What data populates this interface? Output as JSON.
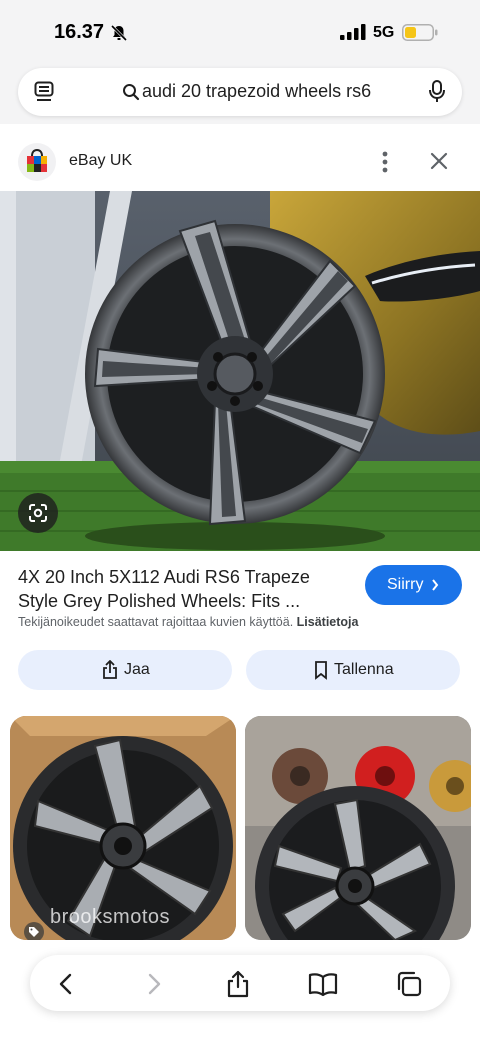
{
  "status_bar": {
    "time": "16.37",
    "network": "5G",
    "battery_color": "#f5c518"
  },
  "search": {
    "query": "audi 20 trapezoid wheels rs6"
  },
  "source": {
    "name": "eBay UK"
  },
  "result": {
    "title_line1": "4X 20 Inch 5X112 Audi RS6 Trapeze",
    "title_line2": "Style Grey Polished Wheels: Fits ...",
    "go_button": "Siirry",
    "copyright_notice": "Tekijänoikeudet saattavat rajoittaa kuvien käyttöä.",
    "more_info_link": "Lisätietoja",
    "share_button": "Jaa",
    "save_button": "Tallenna"
  },
  "related": [
    {
      "watermark": "brooksmotos"
    },
    {
      "watermark": ""
    }
  ],
  "colors": {
    "accent": "#1a73e8",
    "chip_bg": "#e8effd",
    "chrome_bg": "#f4f4f5"
  },
  "icons": [
    "bell-slash-icon",
    "signal-icon",
    "battery-icon",
    "tabs-icon",
    "search-icon",
    "mic-icon",
    "more-vert-icon",
    "close-icon",
    "lens-icon",
    "chevron-right-icon",
    "share-icon",
    "bookmark-icon",
    "tag-icon",
    "back-icon",
    "forward-icon",
    "book-icon",
    "tabs-overview-icon"
  ]
}
